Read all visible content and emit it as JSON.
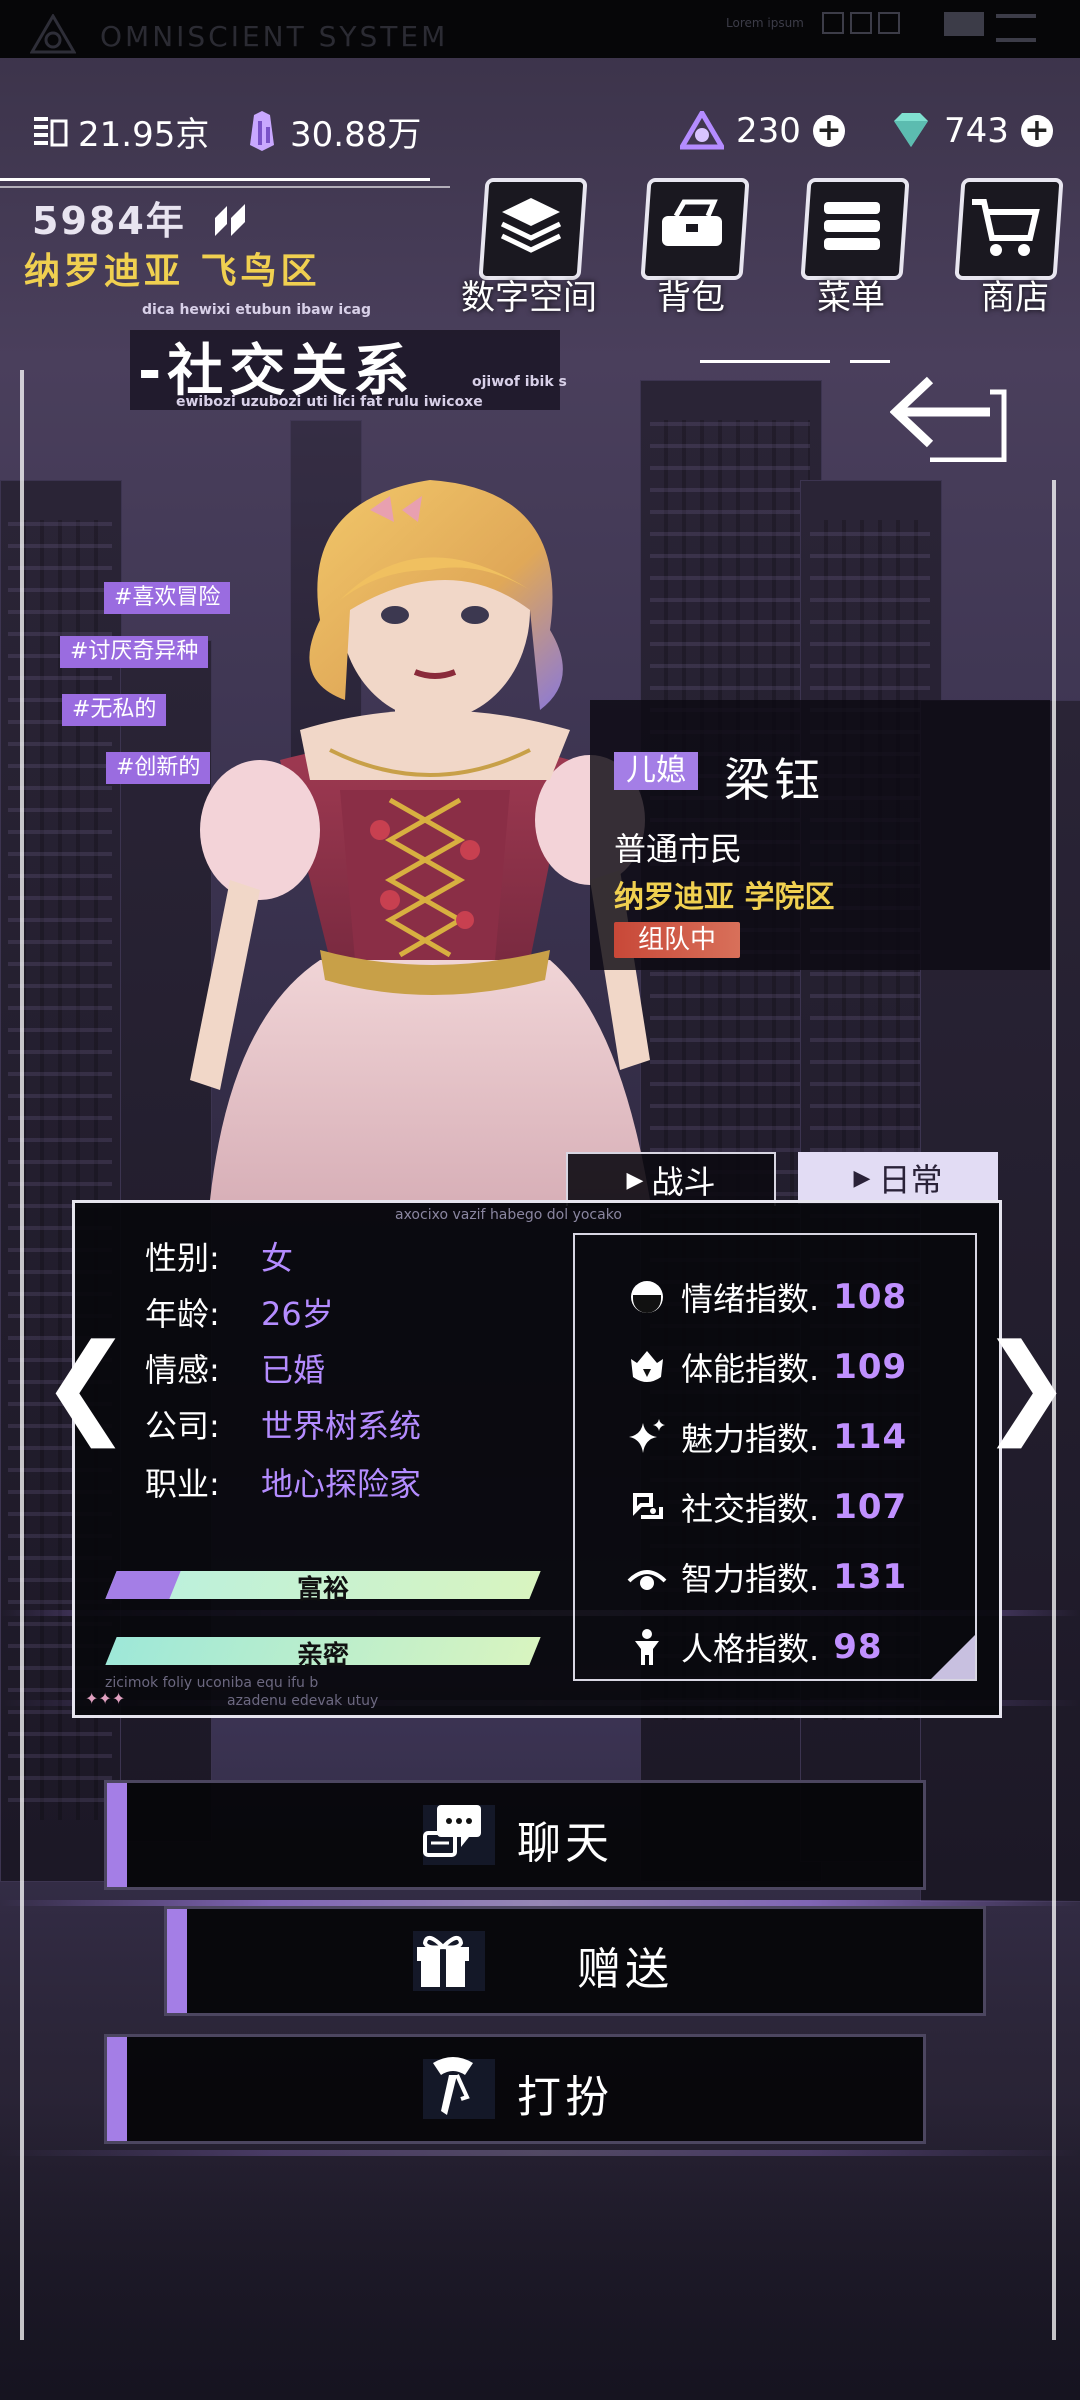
{
  "system": {
    "title": "OMNISCIENT SYSTEM",
    "mini_text": "Lorem ipsum"
  },
  "resources": {
    "currency1": "21.95京",
    "currency2": "30.88万",
    "gems1": "230",
    "gems2": "743",
    "plus": "+"
  },
  "world": {
    "year": "5984年",
    "location": "纳罗迪亚 飞鸟区"
  },
  "nav": [
    {
      "label": "数字空间",
      "icon": "layers-icon"
    },
    {
      "label": "背包",
      "icon": "bag-icon"
    },
    {
      "label": "菜单",
      "icon": "menu-icon"
    },
    {
      "label": "商店",
      "icon": "cart-icon"
    }
  ],
  "page": {
    "title": "社交关系",
    "title_prefix": "-",
    "small_top": "dica hewixi etubun ibaw icag",
    "small_bottom": "ewibozi uzubozi uti lici fat rulu iwicoxe",
    "small_right": "ojiwof ibik s"
  },
  "tags": [
    "#喜欢冒险",
    "#讨厌奇异种",
    "#无私的",
    "#创新的"
  ],
  "character": {
    "relation": "儿媳",
    "name": "梁钰",
    "occupation": "普通市民",
    "location": "纳罗迪亚 学院区",
    "status": "组队中"
  },
  "tabs": {
    "battle": "战斗",
    "daily": "日常"
  },
  "panel_caption": "axocixo vazif habego dol yocako",
  "profile": [
    {
      "label": "性别:",
      "value": "女"
    },
    {
      "label": "年龄:",
      "value": "26岁"
    },
    {
      "label": "情感:",
      "value": "已婚"
    },
    {
      "label": "公司:",
      "value": "世界树系统"
    },
    {
      "label": "职业:",
      "value": "地心探险家"
    }
  ],
  "bars": [
    {
      "label": "富裕",
      "fill_fraction": 0.15
    },
    {
      "label": "亲密",
      "fill_fraction": 0.0
    }
  ],
  "stats": [
    {
      "label": "情绪指数.",
      "value": "108",
      "icon": "mood-icon"
    },
    {
      "label": "体能指数.",
      "value": "109",
      "icon": "stamina-icon"
    },
    {
      "label": "魅力指数.",
      "value": "114",
      "icon": "sparkle-icon"
    },
    {
      "label": "社交指数.",
      "value": "107",
      "icon": "social-icon"
    },
    {
      "label": "智力指数.",
      "value": "131",
      "icon": "eye-icon"
    },
    {
      "label": "人格指数.",
      "value": "98",
      "icon": "person-icon"
    }
  ],
  "panel_footer": {
    "left": "zicimok foliy uconiba equ ifu b",
    "right": "azadenu edevak utuy"
  },
  "actions": [
    {
      "label": "聊天",
      "icon": "chat-icon"
    },
    {
      "label": "赠送",
      "icon": "gift-icon"
    },
    {
      "label": "打扮",
      "icon": "dress-icon"
    }
  ],
  "colors": {
    "accent": "#a47ee6",
    "gold": "#f0d050",
    "stat_value": "#c090ff"
  }
}
